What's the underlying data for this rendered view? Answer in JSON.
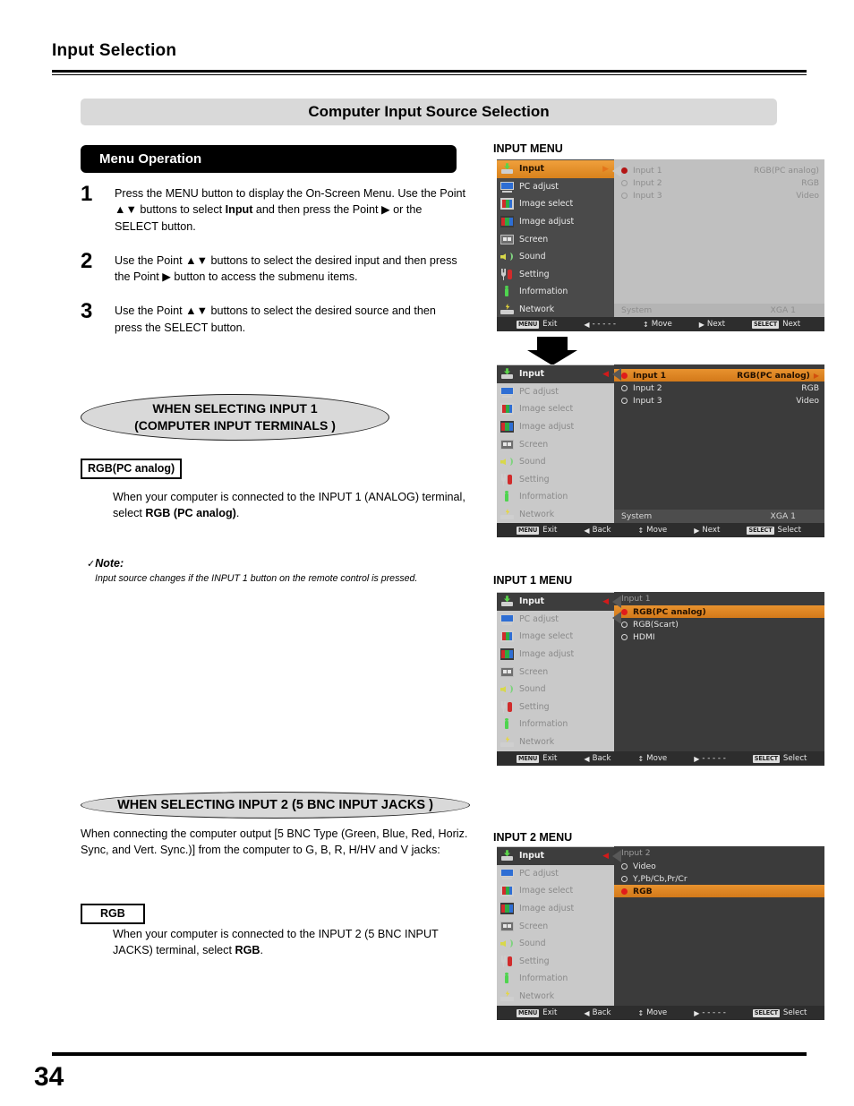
{
  "header": {
    "section_title": "Input Selection",
    "banner_title": "Computer Input Source Selection"
  },
  "menu_operation": {
    "pill_label": "Menu Operation",
    "steps": [
      {
        "num": "1",
        "html": "Press the MENU button to display the On-Screen Menu. Use the Point ▲▼ buttons to select <b>Input</b> and then press the Point ▶ or the SELECT button."
      },
      {
        "num": "2",
        "html": "Use the Point ▲▼ buttons to select the desired input and then press the Point ▶ button to access the submenu items."
      },
      {
        "num": "3",
        "html": "Use the Point ▲▼ buttons to select the desired source and then press the SELECT button."
      }
    ]
  },
  "input1_section": {
    "oval_line1": "WHEN SELECTING INPUT 1",
    "oval_line2": "(COMPUTER INPUT TERMINALS )",
    "box_label": "RGB(PC analog)",
    "paragraph_html": "When your computer is connected to the INPUT 1 (ANALOG) terminal, select <b>RGB (PC analog)</b>.",
    "note_check": "✓",
    "note_head": "Note:",
    "note_body": "Input source changes if the INPUT 1 button on the remote control is pressed."
  },
  "input2_section": {
    "oval_label": "WHEN SELECTING INPUT 2 (5 BNC INPUT JACKS )",
    "paragraph_html": "When connecting the computer output [5 BNC Type (Green, Blue, Red, Horiz. Sync, and Vert. Sync.)] from the computer to G, B, R, H/HV and V jacks:",
    "box_label": "RGB",
    "box_paragraph_html": "When your computer is connected to the INPUT 2 (5 BNC INPUT JACKS) terminal, select <b>RGB</b>."
  },
  "captions": {
    "input_menu": "INPUT MENU",
    "input1_menu": "INPUT 1 MENU",
    "input2_menu": "INPUT 2 MENU"
  },
  "sidebar_items": [
    {
      "label": "Input",
      "icon": "projector-input-icon"
    },
    {
      "label": "PC adjust",
      "icon": "monitor-icon"
    },
    {
      "label": "Image select",
      "icon": "image-select-icon"
    },
    {
      "label": "Image adjust",
      "icon": "image-adjust-icon"
    },
    {
      "label": "Screen",
      "icon": "screen-icon"
    },
    {
      "label": "Sound",
      "icon": "speaker-icon"
    },
    {
      "label": "Setting",
      "icon": "wrench-screwdriver-icon"
    },
    {
      "label": "Information",
      "icon": "info-icon"
    },
    {
      "label": "Network",
      "icon": "network-icon"
    }
  ],
  "osd_input_menu": {
    "rows": [
      {
        "label": "Input 1",
        "value": "RGB(PC analog)",
        "selected": true
      },
      {
        "label": "Input 2",
        "value": "RGB",
        "selected": false
      },
      {
        "label": "Input 3",
        "value": "Video",
        "selected": false
      }
    ],
    "system_label": "System",
    "system_value": "XGA 1",
    "bar": [
      {
        "key": "MENU",
        "glyph": "",
        "label": "Exit"
      },
      {
        "key": "",
        "glyph": "◀",
        "label": "- - - - -"
      },
      {
        "key": "",
        "glyph": "↕",
        "label": "Move"
      },
      {
        "key": "",
        "glyph": "▶",
        "label": "Next"
      },
      {
        "key": "SELECT",
        "glyph": "",
        "label": "Next"
      }
    ]
  },
  "osd_input_menu_active": {
    "rows": [
      {
        "label": "Input 1",
        "value": "RGB(PC analog)",
        "selected": true
      },
      {
        "label": "Input 2",
        "value": "RGB",
        "selected": false
      },
      {
        "label": "Input 3",
        "value": "Video",
        "selected": false
      }
    ],
    "system_label": "System",
    "system_value": "XGA 1",
    "bar": [
      {
        "key": "MENU",
        "glyph": "",
        "label": "Exit"
      },
      {
        "key": "",
        "glyph": "◀",
        "label": "Back"
      },
      {
        "key": "",
        "glyph": "↕",
        "label": "Move"
      },
      {
        "key": "",
        "glyph": "▶",
        "label": "Next"
      },
      {
        "key": "SELECT",
        "glyph": "",
        "label": "Select"
      }
    ]
  },
  "osd_input1_menu": {
    "panel_head": "Input 1",
    "rows": [
      {
        "label": "RGB(PC analog)",
        "selected": true
      },
      {
        "label": "RGB(Scart)",
        "selected": false
      },
      {
        "label": "HDMI",
        "selected": false
      }
    ],
    "bar": [
      {
        "key": "MENU",
        "glyph": "",
        "label": "Exit"
      },
      {
        "key": "",
        "glyph": "◀",
        "label": "Back"
      },
      {
        "key": "",
        "glyph": "↕",
        "label": "Move"
      },
      {
        "key": "",
        "glyph": "▶",
        "label": "- - - - -"
      },
      {
        "key": "SELECT",
        "glyph": "",
        "label": "Select"
      }
    ]
  },
  "osd_input2_menu": {
    "panel_head": "Input 2",
    "rows": [
      {
        "label": "Video",
        "selected": false
      },
      {
        "label": "Y,Pb/Cb,Pr/Cr",
        "selected": false
      },
      {
        "label": "RGB",
        "selected": true
      }
    ],
    "bar": [
      {
        "key": "MENU",
        "glyph": "",
        "label": "Exit"
      },
      {
        "key": "",
        "glyph": "◀",
        "label": "Back"
      },
      {
        "key": "",
        "glyph": "↕",
        "label": "Move"
      },
      {
        "key": "",
        "glyph": "▶",
        "label": "- - - - -"
      },
      {
        "key": "SELECT",
        "glyph": "",
        "label": "Select"
      }
    ]
  },
  "footer": {
    "page_number": "34"
  },
  "colors": {
    "highlight_orange": "#e8922e",
    "radio_red": "#e01b1b",
    "banner_gray": "#d9d9d9",
    "osd_dark": "#3b3b3b",
    "osd_light": "#c0c0c0"
  }
}
